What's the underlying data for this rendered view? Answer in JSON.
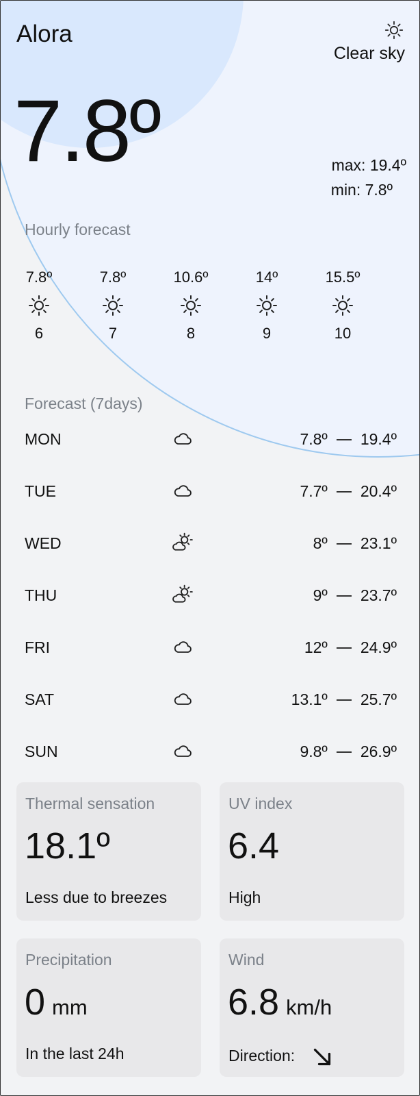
{
  "location": {
    "city": "Alora"
  },
  "current": {
    "condition": "Clear sky",
    "condition_icon": "sun-icon",
    "temperature": "7.8º",
    "max": "max: 19.4º",
    "min": "min: 7.8º"
  },
  "hourly": {
    "title": "Hourly forecast",
    "items": [
      {
        "temp": "7.8º",
        "icon": "sun-icon",
        "hour": "6"
      },
      {
        "temp": "7.8º",
        "icon": "sun-icon",
        "hour": "7"
      },
      {
        "temp": "10.6º",
        "icon": "sun-icon",
        "hour": "8"
      },
      {
        "temp": "14º",
        "icon": "sun-icon",
        "hour": "9"
      },
      {
        "temp": "15.5º",
        "icon": "sun-icon",
        "hour": "10"
      }
    ]
  },
  "forecast": {
    "title": "Forecast (7days)",
    "days": [
      {
        "day": "MON",
        "icon": "cloud-icon",
        "min": "7.8º",
        "max": "19.4º"
      },
      {
        "day": "TUE",
        "icon": "cloud-icon",
        "min": "7.7º",
        "max": "20.4º"
      },
      {
        "day": "WED",
        "icon": "partly-cloudy-icon",
        "min": "8º",
        "max": "23.1º"
      },
      {
        "day": "THU",
        "icon": "partly-cloudy-icon",
        "min": "9º",
        "max": "23.7º"
      },
      {
        "day": "FRI",
        "icon": "cloud-icon",
        "min": "12º",
        "max": "24.9º"
      },
      {
        "day": "SAT",
        "icon": "cloud-icon",
        "min": "13.1º",
        "max": "25.7º"
      },
      {
        "day": "SUN",
        "icon": "cloud-icon",
        "min": "9.8º",
        "max": "26.9º"
      }
    ]
  },
  "cards": {
    "thermal": {
      "title": "Thermal sensation",
      "value": "18.1º",
      "subtitle": "Less due to breezes"
    },
    "uv": {
      "title": "UV index",
      "value": "6.4",
      "subtitle": "High"
    },
    "precipitation": {
      "title": "Precipitation",
      "value": "0",
      "unit": "mm",
      "subtitle": "In the last 24h"
    },
    "wind": {
      "title": "Wind",
      "value": "6.8",
      "unit": "km/h",
      "subtitle": "Direction:",
      "direction_icon": "arrow-down-right-icon"
    }
  }
}
